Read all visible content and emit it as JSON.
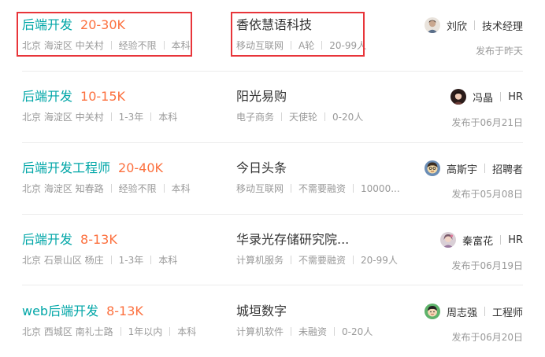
{
  "jobs": [
    {
      "title": "后端开发",
      "salary": "20-30K",
      "location": "北京 海淀区 中关村",
      "experience": "经验不限",
      "education": "本科",
      "company": "香依慧语科技",
      "industry": "移动互联网",
      "funding": "A轮",
      "size": "20-99人",
      "hr_name": "刘欣",
      "hr_title": "技术经理",
      "published": "发布于昨天"
    },
    {
      "title": "后端开发",
      "salary": "10-15K",
      "location": "北京 海淀区 中关村",
      "experience": "1-3年",
      "education": "本科",
      "company": "阳光易购",
      "industry": "电子商务",
      "funding": "天使轮",
      "size": "0-20人",
      "hr_name": "冯晶",
      "hr_title": "HR",
      "published": "发布于06月21日"
    },
    {
      "title": "后端开发工程师",
      "salary": "20-40K",
      "location": "北京 海淀区 知春路",
      "experience": "经验不限",
      "education": "本科",
      "company": "今日头条",
      "industry": "移动互联网",
      "funding": "不需要融资",
      "size": "10000...",
      "hr_name": "高斯宇",
      "hr_title": "招聘者",
      "published": "发布于05月08日"
    },
    {
      "title": "后端开发",
      "salary": "8-13K",
      "location": "北京 石景山区 杨庄",
      "experience": "1-3年",
      "education": "本科",
      "company": "华录光存储研究院...",
      "industry": "计算机服务",
      "funding": "不需要融资",
      "size": "20-99人",
      "hr_name": "秦富花",
      "hr_title": "HR",
      "published": "发布于06月19日"
    },
    {
      "title": "web后端开发",
      "salary": "8-13K",
      "location": "北京 西城区 南礼士路",
      "experience": "1年以内",
      "education": "本科",
      "company": "城垣数字",
      "industry": "计算机软件",
      "funding": "未融资",
      "size": "0-20人",
      "hr_name": "周志强",
      "hr_title": "工程师",
      "published": "发布于06月20日"
    }
  ],
  "colors": {
    "job_name": "#00a6a7",
    "salary": "#fc703e",
    "highlight_border": "#e8353a",
    "meta_text": "#999999"
  },
  "icons": [
    "avatar-liu-xin-icon",
    "avatar-feng-jing-icon",
    "avatar-gao-siyu-icon",
    "avatar-qin-fuhua-icon",
    "avatar-zhou-zhiqiang-icon"
  ]
}
